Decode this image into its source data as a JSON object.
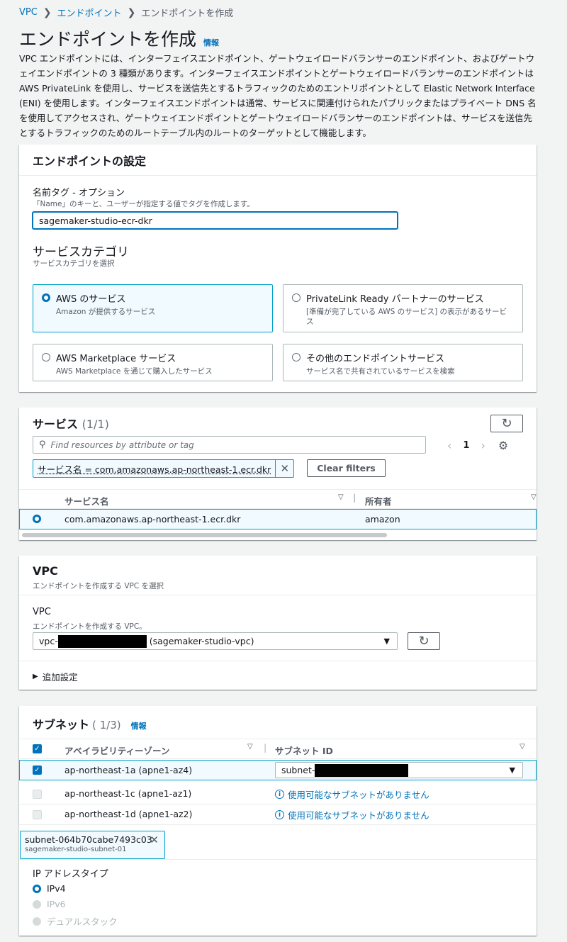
{
  "breadcrumb": {
    "item1": "VPC",
    "item2": "エンドポイント",
    "item3": "エンドポイントを作成"
  },
  "page": {
    "title": "エンドポイントを作成",
    "info": "情報",
    "description": "VPC エンドポイントには、インターフェイスエンドポイント、ゲートウェイロードバランサーのエンドポイント、およびゲートウェイエンドポイントの 3 種類があります。インターフェイスエンドポイントとゲートウェイロードバランサーのエンドポイントは AWS PrivateLink を使用し、サービスを送信先とするトラフィックのためのエントリポイントとして Elastic Network Interface (ENI) を使用します。インターフェイスエンドポイントは通常、サービスに関連付けられたパブリックまたはプライベート DNS 名を使用してアクセスされ、ゲートウェイエンドポイントとゲートウェイロードバランサーのエンドポイントは、サービスを送信先とするトラフィックのためのルートテーブル内のルートのターゲットとして機能します。"
  },
  "endpoint_settings": {
    "title": "エンドポイントの設定",
    "name_label": "名前タグ - オプション",
    "name_desc": "「Name」のキーと、ユーザーが指定する値でタグを作成します。",
    "name_value": "sagemaker-studio-ecr-dkr",
    "category_title": "サービスカテゴリ",
    "category_desc": "サービスカテゴリを選択",
    "tiles": [
      {
        "title": "AWS のサービス",
        "desc": "Amazon が提供するサービス"
      },
      {
        "title": "PrivateLink Ready パートナーのサービス",
        "desc": "[準備が完了している AWS のサービス] の表示があるサービス"
      },
      {
        "title": "AWS Marketplace サービス",
        "desc": "AWS Marketplace を通じて購入したサービス"
      },
      {
        "title": "その他のエンドポイントサービス",
        "desc": "サービス名で共有されているサービスを検索"
      }
    ]
  },
  "services": {
    "title": "サービス",
    "count": "(1/1)",
    "search_placeholder": "Find resources by attribute or tag",
    "page": "1",
    "filter_token": "サービス名 = com.amazonaws.ap-northeast-1.ecr.dkr",
    "clear_filters": "Clear filters",
    "columns": [
      "サービス名",
      "所有者"
    ],
    "rows": [
      {
        "name": "com.amazonaws.ap-northeast-1.ecr.dkr",
        "owner": "amazon"
      }
    ]
  },
  "vpc": {
    "title": "VPC",
    "desc": "エンドポイントを作成する VPC を選択",
    "field_label": "VPC",
    "field_desc": "エンドポイントを作成する VPC。",
    "value_prefix": "vpc-",
    "value_suffix": "(sagemaker-studio-vpc)",
    "additional_settings": "追加設定"
  },
  "subnets": {
    "title": "サブネット",
    "count": "( 1/3)",
    "info": "情報",
    "columns": [
      "アベイラビリティーゾーン",
      "サブネット ID"
    ],
    "rows": [
      {
        "az": "ap-northeast-1a (apne1-az4)",
        "subnet_prefix": "subnet-"
      },
      {
        "az": "ap-northeast-1c (apne1-az1)",
        "message": "使用可能なサブネットがありません"
      },
      {
        "az": "ap-northeast-1d (apne1-az2)",
        "message": "使用可能なサブネットがありません"
      }
    ],
    "token_id": "subnet-064b70cabe7493c03",
    "token_name": "sagemaker-studio-subnet-01",
    "ip_label": "IP アドレスタイプ",
    "ip_options": [
      "IPv4",
      "IPv6",
      "デュアルスタック"
    ]
  },
  "colors": {
    "accent": "#0073bb",
    "selected_bg": "#f1faff",
    "selected_border": "#00a1c9",
    "page_bg": "#f2f3f3"
  }
}
